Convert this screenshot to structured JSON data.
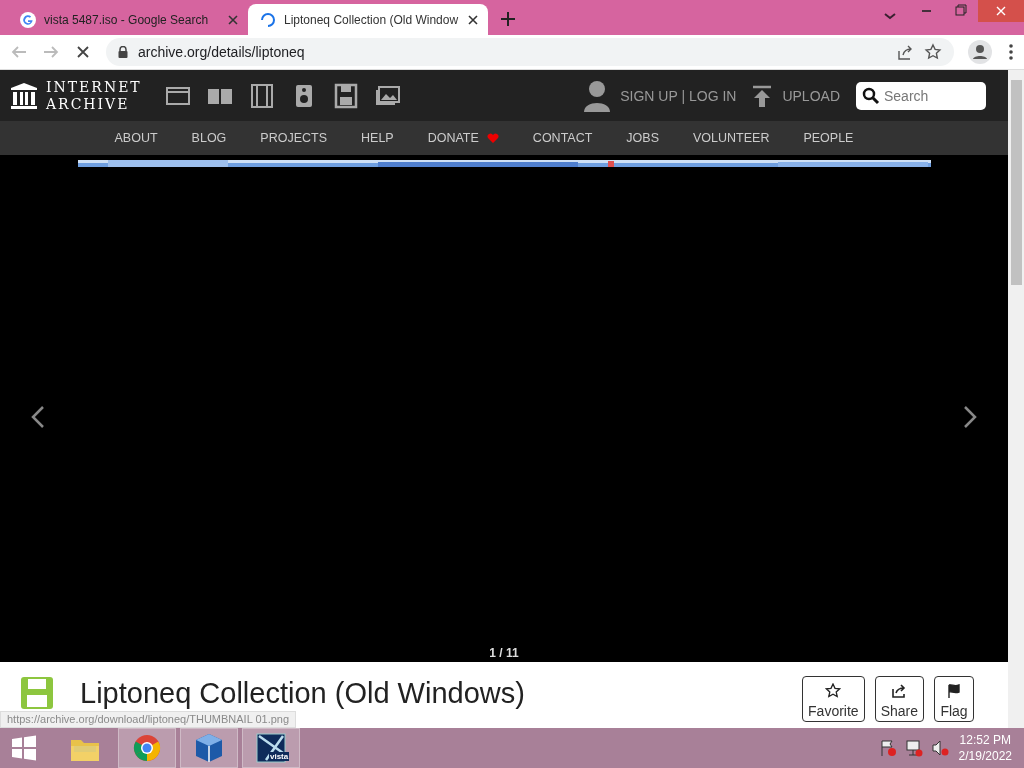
{
  "browser": {
    "tabs": [
      {
        "title": "vista 5487.iso - Google Search",
        "selected": false,
        "loading": false
      },
      {
        "title": "Liptoneq Collection (Old Window",
        "selected": true,
        "loading": true
      }
    ],
    "address": "archive.org/details/liptoneq"
  },
  "site": {
    "logo": [
      "INTERNET",
      "ARCHIVE"
    ],
    "account": "SIGN UP | LOG IN",
    "upload": "UPLOAD",
    "search": {
      "placeholder": "Search"
    },
    "nav": [
      {
        "label": "ABOUT",
        "heart": false
      },
      {
        "label": "BLOG",
        "heart": false
      },
      {
        "label": "PROJECTS",
        "heart": false
      },
      {
        "label": "HELP",
        "heart": false
      },
      {
        "label": "DONATE",
        "heart": true
      },
      {
        "label": "CONTACT",
        "heart": false
      },
      {
        "label": "JOBS",
        "heart": false
      },
      {
        "label": "VOLUNTEER",
        "heart": false
      },
      {
        "label": "PEOPLE",
        "heart": false
      }
    ]
  },
  "carousel": {
    "counter": "1 / 11"
  },
  "item": {
    "title": "Liptoneq Collection (Old Windows)",
    "actions": [
      {
        "kind": "favorite",
        "label": "Favorite"
      },
      {
        "kind": "share",
        "label": "Share"
      },
      {
        "kind": "flag",
        "label": "Flag"
      }
    ]
  },
  "status_url": "https://archive.org/download/liptoneq/THUMBNAIL 01.png",
  "taskbar": {
    "apps": [
      {
        "kind": "explorer",
        "running": false
      },
      {
        "kind": "chrome",
        "running": true
      },
      {
        "kind": "virtualbox",
        "running": true
      },
      {
        "kind": "vista",
        "running": true,
        "label": "vista"
      }
    ],
    "time": "12:52 PM",
    "date": "2/19/2022"
  }
}
